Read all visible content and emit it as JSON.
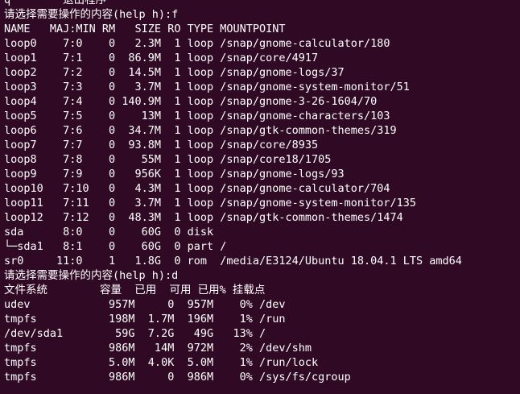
{
  "terminal": {
    "background": "#300a24",
    "foreground": "#ffffff",
    "lines": [
      "q        退出程序",
      "请选择需要操作的内容(help h):f",
      "NAME   MAJ:MIN RM   SIZE RO TYPE MOUNTPOINT",
      "loop0    7:0    0   2.3M  1 loop /snap/gnome-calculator/180",
      "loop1    7:1    0  86.9M  1 loop /snap/core/4917",
      "loop2    7:2    0  14.5M  1 loop /snap/gnome-logs/37",
      "loop3    7:3    0   3.7M  1 loop /snap/gnome-system-monitor/51",
      "loop4    7:4    0 140.9M  1 loop /snap/gnome-3-26-1604/70",
      "loop5    7:5    0    13M  1 loop /snap/gnome-characters/103",
      "loop6    7:6    0  34.7M  1 loop /snap/gtk-common-themes/319",
      "loop7    7:7    0  93.8M  1 loop /snap/core/8935",
      "loop8    7:8    0    55M  1 loop /snap/core18/1705",
      "loop9    7:9    0   956K  1 loop /snap/gnome-logs/93",
      "loop10   7:10   0   4.3M  1 loop /snap/gnome-calculator/704",
      "loop11   7:11   0   3.7M  1 loop /snap/gnome-system-monitor/135",
      "loop12   7:12   0  48.3M  1 loop /snap/gtk-common-themes/1474",
      "sda      8:0    0    60G  0 disk",
      "└─sda1   8:1    0    60G  0 part /",
      "sr0     11:0    1   1.8G  0 rom  /media/E3124/Ubuntu 18.04.1 LTS amd64",
      "请选择需要操作的内容(help h):d",
      "文件系统        容量  已用  可用 已用% 挂载点",
      "udev            957M     0  957M    0% /dev",
      "tmpfs           198M  1.7M  196M    1% /run",
      "/dev/sda1        59G  7.2G   49G   13% /",
      "tmpfs           986M   14M  972M    2% /dev/shm",
      "tmpfs           5.0M  4.0K  5.0M    1% /run/lock",
      "tmpfs           986M     0  986M    0% /sys/fs/cgroup"
    ]
  }
}
